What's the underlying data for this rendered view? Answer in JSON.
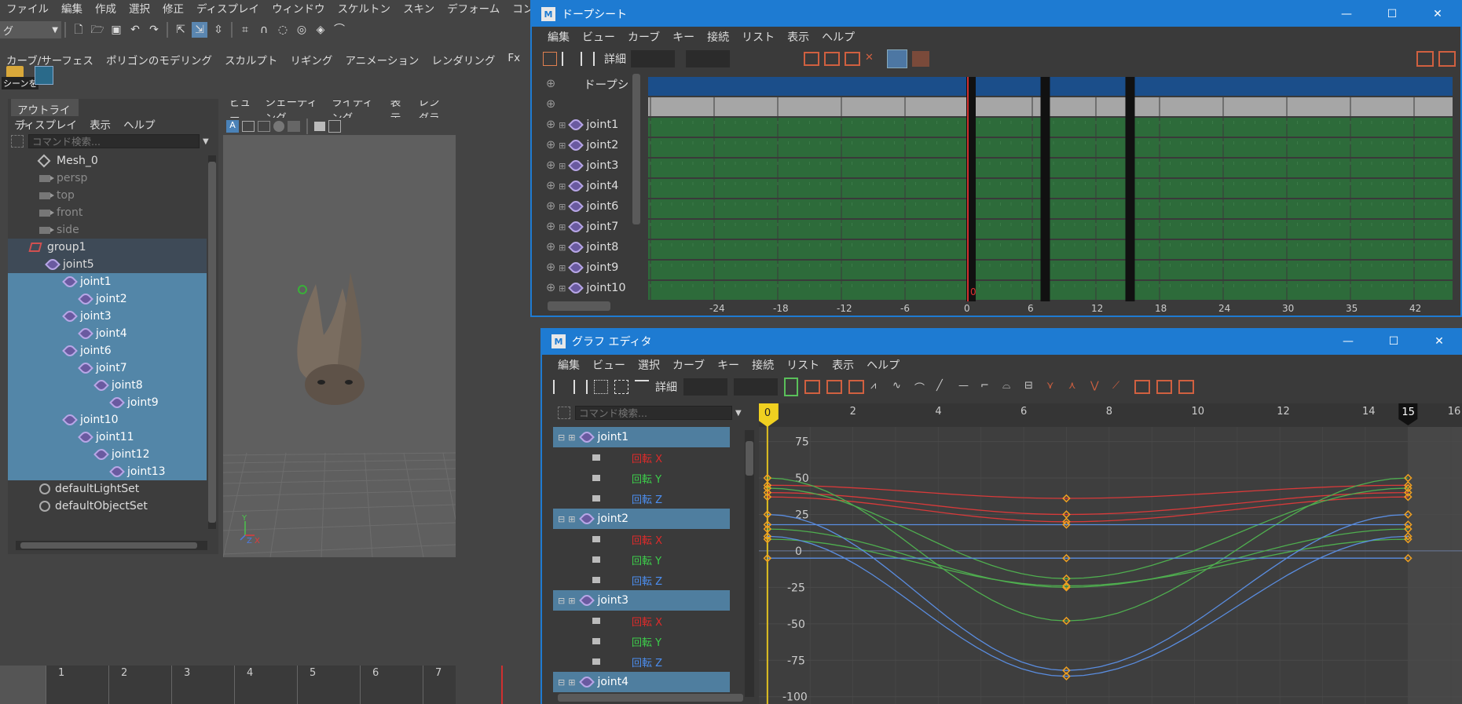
{
  "main_menu": [
    "ファイル",
    "編集",
    "作成",
    "選択",
    "修正",
    "ディスプレイ",
    "ウィンドウ",
    "スケルトン",
    "スキン",
    "デフォーム",
    "コンストレイント"
  ],
  "mode_select": "グ",
  "shelf_tabs": [
    "カーブ/サーフェス",
    "ポリゴンのモデリング",
    "スカルプト",
    "リギング",
    "アニメーション",
    "レンダリング",
    "Fx"
  ],
  "shelf_item_label": "シーンを",
  "outliner": {
    "tab": "アウトライナ",
    "menu": [
      "ディスプレイ",
      "表示",
      "ヘルプ"
    ],
    "search_placeholder": "コマンド検索...",
    "items": [
      {
        "label": "Mesh_0",
        "icon": "mesh-icon",
        "style": "normal"
      },
      {
        "label": "persp",
        "icon": "camera-icon",
        "style": "dim"
      },
      {
        "label": "top",
        "icon": "camera-icon",
        "style": "dim"
      },
      {
        "label": "front",
        "icon": "camera-icon",
        "style": "dim"
      },
      {
        "label": "side",
        "icon": "camera-icon",
        "style": "dim"
      },
      {
        "label": "group1",
        "icon": "group-icon",
        "style": "grp"
      },
      {
        "label": "joint5",
        "icon": "joint-icon",
        "style": "grp"
      },
      {
        "label": "joint1",
        "icon": "joint-icon",
        "style": "sel"
      },
      {
        "label": "joint2",
        "icon": "joint-icon",
        "style": "sel"
      },
      {
        "label": "joint3",
        "icon": "joint-icon",
        "style": "sel"
      },
      {
        "label": "joint4",
        "icon": "joint-icon",
        "style": "sel"
      },
      {
        "label": "joint6",
        "icon": "joint-icon",
        "style": "sel"
      },
      {
        "label": "joint7",
        "icon": "joint-icon",
        "style": "sel"
      },
      {
        "label": "joint8",
        "icon": "joint-icon",
        "style": "sel"
      },
      {
        "label": "joint9",
        "icon": "joint-icon",
        "style": "sel"
      },
      {
        "label": "joint10",
        "icon": "joint-icon",
        "style": "sel"
      },
      {
        "label": "joint11",
        "icon": "joint-icon",
        "style": "sel"
      },
      {
        "label": "joint12",
        "icon": "joint-icon",
        "style": "sel"
      },
      {
        "label": "joint13",
        "icon": "joint-icon",
        "style": "sel"
      },
      {
        "label": "defaultLightSet",
        "icon": "set-icon",
        "style": "normal"
      },
      {
        "label": "defaultObjectSet",
        "icon": "set-icon",
        "style": "normal"
      }
    ]
  },
  "viewport": {
    "menu": [
      "ビュー",
      "シェーディング",
      "ライティング",
      "表示",
      "レンダラ"
    ],
    "axis_x": "X",
    "axis_y": "Y",
    "axis_z": "Z"
  },
  "timeline": {
    "ticks": [
      "1",
      "2",
      "3",
      "4",
      "5",
      "6",
      "7"
    ]
  },
  "dopesheet": {
    "title": "ドープシート",
    "menu": [
      "編集",
      "ビュー",
      "カーブ",
      "キー",
      "接続",
      "リスト",
      "表示",
      "ヘルプ"
    ],
    "detail_label": "詳細",
    "summary_label": "ドープシ",
    "joints": [
      "joint1",
      "joint2",
      "joint3",
      "joint4",
      "joint6",
      "joint7",
      "joint8",
      "joint9",
      "joint10"
    ],
    "ruler": [
      "-24",
      "-18",
      "-12",
      "-6",
      "0",
      "6",
      "12",
      "18",
      "24",
      "30",
      "35",
      "42"
    ],
    "current_frame": "0",
    "colors": {
      "summary": "#1b4e8a",
      "gray": "#a6a6a6",
      "green": "#2d6b3a"
    }
  },
  "graph_editor": {
    "title": "グラフ エディタ",
    "menu": [
      "編集",
      "ビュー",
      "選択",
      "カーブ",
      "キー",
      "接続",
      "リスト",
      "表示",
      "ヘルプ"
    ],
    "detail_label": "詳細",
    "search_placeholder": "コマンド検索...",
    "rows": [
      {
        "type": "joint",
        "label": "joint1"
      },
      {
        "type": "attr",
        "label": "回転 X",
        "color": "#e02a2a"
      },
      {
        "type": "attr",
        "label": "回転 Y",
        "color": "#3ccf4b"
      },
      {
        "type": "attr",
        "label": "回転 Z",
        "color": "#4c8ef0"
      },
      {
        "type": "joint",
        "label": "joint2"
      },
      {
        "type": "attr",
        "label": "回転 X",
        "color": "#e02a2a"
      },
      {
        "type": "attr",
        "label": "回転 Y",
        "color": "#3ccf4b"
      },
      {
        "type": "attr",
        "label": "回転 Z",
        "color": "#4c8ef0"
      },
      {
        "type": "joint",
        "label": "joint3"
      },
      {
        "type": "attr",
        "label": "回転 X",
        "color": "#e02a2a"
      },
      {
        "type": "attr",
        "label": "回転 Y",
        "color": "#3ccf4b"
      },
      {
        "type": "attr",
        "label": "回転 Z",
        "color": "#4c8ef0"
      },
      {
        "type": "joint",
        "label": "joint4"
      }
    ],
    "x_ticks": [
      "0",
      "2",
      "4",
      "6",
      "8",
      "10",
      "12",
      "14",
      "15",
      "16"
    ],
    "y_ticks": [
      "75",
      "50",
      "25",
      "0",
      "-25",
      "-50",
      "-75",
      "-100"
    ],
    "current_frame_label": "0",
    "end_frame_label": "15"
  },
  "chart_data": {
    "type": "line",
    "xlim": [
      -0.2,
      16.3
    ],
    "ylim": [
      -105,
      85
    ],
    "series": [
      {
        "color": "#d83a3a",
        "x": [
          0,
          7,
          15
        ],
        "y": [
          45,
          36,
          45
        ]
      },
      {
        "color": "#d83a3a",
        "x": [
          0,
          7,
          15
        ],
        "y": [
          40,
          25,
          40
        ]
      },
      {
        "color": "#d83a3a",
        "x": [
          0,
          7,
          15
        ],
        "y": [
          37,
          20,
          37
        ]
      },
      {
        "color": "#4fae4f",
        "x": [
          0,
          7,
          15
        ],
        "y": [
          50,
          -48,
          50
        ]
      },
      {
        "color": "#4fae4f",
        "x": [
          0,
          7,
          15
        ],
        "y": [
          43,
          -19,
          43
        ]
      },
      {
        "color": "#4fae4f",
        "x": [
          0,
          7,
          15
        ],
        "y": [
          15,
          -25,
          15
        ]
      },
      {
        "color": "#4fae4f",
        "x": [
          0,
          7,
          15
        ],
        "y": [
          8,
          -24,
          8
        ]
      },
      {
        "color": "#5a8de0",
        "x": [
          0,
          7,
          15
        ],
        "y": [
          25,
          -82,
          25
        ]
      },
      {
        "color": "#5a8de0",
        "x": [
          0,
          7,
          15
        ],
        "y": [
          18,
          18,
          18
        ]
      },
      {
        "color": "#5a8de0",
        "x": [
          0,
          7,
          15
        ],
        "y": [
          10,
          -86,
          10
        ]
      },
      {
        "color": "#5a8de0",
        "x": [
          0,
          7,
          15
        ],
        "y": [
          -5,
          -5,
          -5
        ]
      }
    ]
  }
}
